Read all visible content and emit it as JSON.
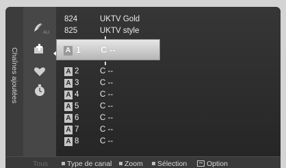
{
  "sidebar": {
    "label": "Chaînes ajoutées"
  },
  "icons": [
    "satellite-icon",
    "add-channel-icon",
    "heart-icon",
    "clock-icon"
  ],
  "channels_top": [
    {
      "number": "824",
      "name": "UKTV Gold"
    },
    {
      "number": "825",
      "name": "UKTV style"
    }
  ],
  "selected": {
    "badge": "A",
    "number": "1",
    "name": "C --"
  },
  "channels": [
    {
      "badge": "A",
      "number": "2",
      "name": "C --"
    },
    {
      "badge": "A",
      "number": "3",
      "name": "C --"
    },
    {
      "badge": "A",
      "number": "4",
      "name": "C --"
    },
    {
      "badge": "A",
      "number": "5",
      "name": "C --"
    },
    {
      "badge": "A",
      "number": "6",
      "name": "C --"
    },
    {
      "badge": "A",
      "number": "7",
      "name": "C --"
    },
    {
      "badge": "A",
      "number": "8",
      "name": "C --"
    }
  ],
  "bottom": {
    "all": "Tous",
    "channel_type": "Type de canal",
    "zoom": "Zoom",
    "select": "Sélection",
    "option": "Option"
  },
  "colors": {
    "frame": "#2b2b2b",
    "highlight": "#d0d0d0",
    "badge": "#c6c6c6"
  }
}
